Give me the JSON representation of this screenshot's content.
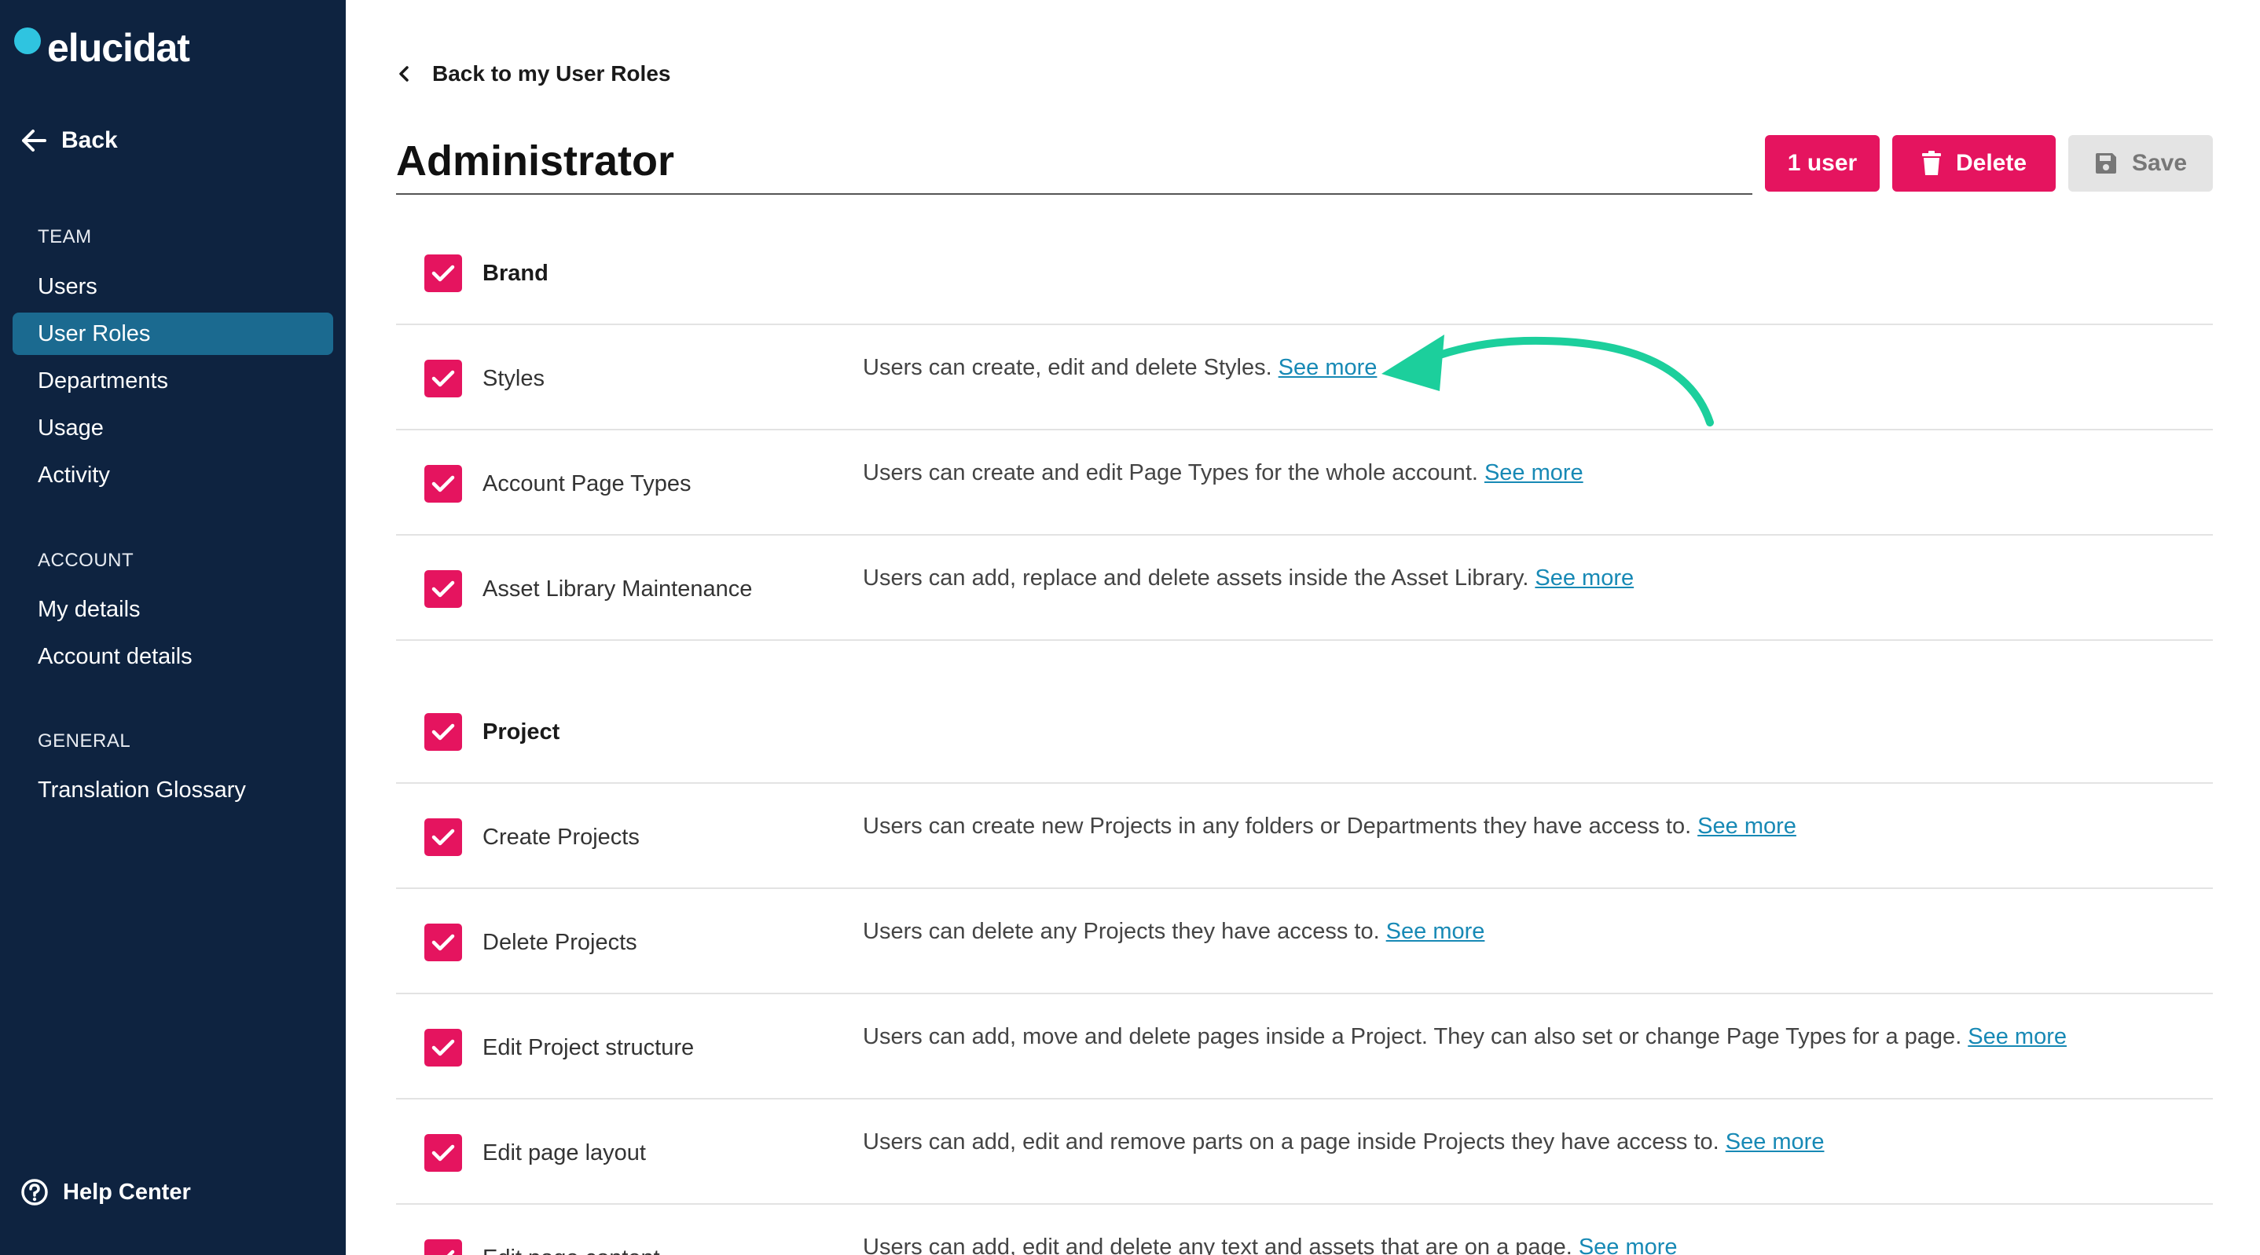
{
  "brand": {
    "logo_text": "elucidat"
  },
  "sidebar": {
    "back_label": "Back",
    "sections": [
      {
        "title": "TEAM",
        "items": [
          "Users",
          "User Roles",
          "Departments",
          "Usage",
          "Activity"
        ]
      },
      {
        "title": "ACCOUNT",
        "items": [
          "My details",
          "Account details"
        ]
      },
      {
        "title": "GENERAL",
        "items": [
          "Translation Glossary"
        ]
      }
    ],
    "active_item": "User Roles",
    "help_label": "Help Center"
  },
  "header": {
    "breadcrumb": "Back to my User Roles",
    "title": "Administrator",
    "users_button": "1 user",
    "delete_button": "Delete",
    "save_button": "Save"
  },
  "permissions": [
    {
      "label": "Brand",
      "group": true,
      "checked": true,
      "desc": "",
      "link": ""
    },
    {
      "label": "Styles",
      "group": false,
      "checked": true,
      "desc": "Users can create, edit and delete Styles.",
      "link": "See more"
    },
    {
      "label": "Account Page Types",
      "group": false,
      "checked": true,
      "desc": "Users can create and edit Page Types for the whole account.",
      "link": "See more"
    },
    {
      "label": "Asset Library Maintenance",
      "group": false,
      "checked": true,
      "desc": "Users can add, replace and delete assets inside the Asset Library.",
      "link": "See more"
    },
    {
      "label": "Project",
      "group": true,
      "checked": true,
      "desc": "",
      "link": ""
    },
    {
      "label": "Create Projects",
      "group": false,
      "checked": true,
      "desc": "Users can create new Projects in any folders or Departments they have access to.",
      "link": "See more"
    },
    {
      "label": "Delete Projects",
      "group": false,
      "checked": true,
      "desc": "Users can delete any Projects they have access to.",
      "link": "See more"
    },
    {
      "label": "Edit Project structure",
      "group": false,
      "checked": true,
      "desc": "Users can add, move and delete pages inside a Project. They can also set or change Page Types for a page.",
      "link": "See more"
    },
    {
      "label": "Edit page layout",
      "group": false,
      "checked": true,
      "desc": "Users can add, edit and remove parts on a page inside Projects they have access to.",
      "link": "See more"
    },
    {
      "label": "Edit page content",
      "group": false,
      "checked": true,
      "desc": "Users can add, edit and delete any text and assets that are on a page.",
      "link": "See more"
    }
  ],
  "colors": {
    "sidebar_bg": "#0e2340",
    "accent": "#e5145f",
    "active_nav": "#1b6a90",
    "link": "#1789b5",
    "arrow": "#1ccf9c"
  }
}
